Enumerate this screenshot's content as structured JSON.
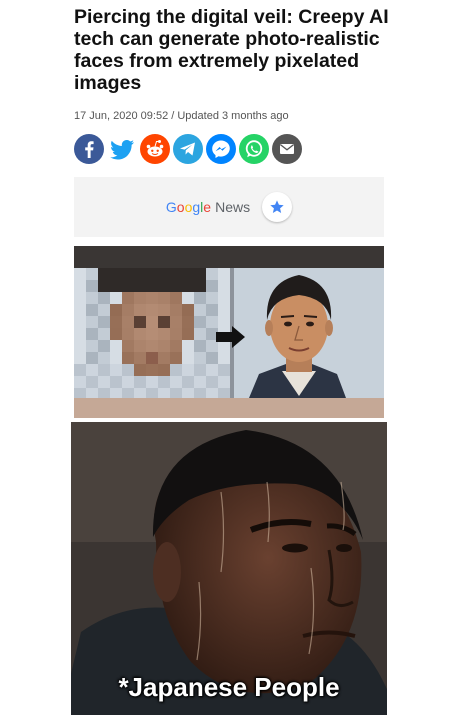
{
  "article": {
    "headline": "Piercing the digital veil: Creepy AI tech can generate photo-realistic faces from extremely pixelated images",
    "meta": "17 Jun, 2020 09:52 / Updated 3 months ago"
  },
  "share": {
    "icons": [
      "facebook-icon",
      "twitter-icon",
      "reddit-icon",
      "telegram-icon",
      "messenger-icon",
      "whatsapp-icon",
      "email-icon"
    ],
    "colors": {
      "facebook": "#3b5998",
      "twitter": "#1da1f2",
      "reddit": "#ff4500",
      "telegram": "#2ca5e0",
      "messenger": "#0084ff",
      "whatsapp": "#25d366",
      "email": "#555555"
    }
  },
  "google_news": {
    "brand": "Google",
    "label": "News",
    "star_icon": "star-icon",
    "star_color": "#4285f4"
  },
  "comparison_image": {
    "left": "pixelated-face",
    "arrow_icon": "arrow-right-icon",
    "right": "generated-face"
  },
  "meme": {
    "caption": "*Japanese People"
  }
}
